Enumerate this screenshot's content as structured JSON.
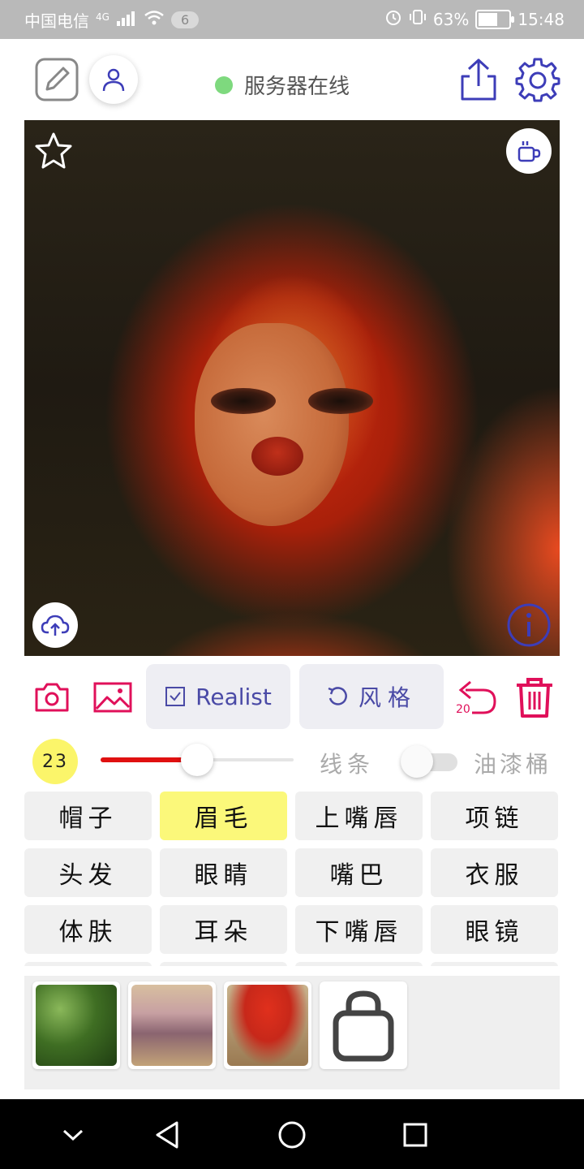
{
  "status_bar": {
    "carrier": "中国电信",
    "network": "4G",
    "notification_count": "6",
    "battery": "63%",
    "battery_level": 0.63,
    "time": "15:48"
  },
  "header": {
    "server_status": "服务器在线",
    "server_status_color": "#7ed97e"
  },
  "toolbar": {
    "model_label": "Realist",
    "style_label": "风格",
    "undo_count": "20",
    "accent_color": "#e0105a"
  },
  "brush": {
    "size": "23",
    "slider_fraction": 0.5,
    "line_label": "线条",
    "bucket_label": "油漆桶",
    "bucket_enabled": false
  },
  "labels": [
    {
      "text": "帽子",
      "selected": false
    },
    {
      "text": "眉毛",
      "selected": true
    },
    {
      "text": "上嘴唇",
      "selected": false
    },
    {
      "text": "项链",
      "selected": false
    },
    {
      "text": "头发",
      "selected": false
    },
    {
      "text": "眼睛",
      "selected": false
    },
    {
      "text": "嘴巴",
      "selected": false
    },
    {
      "text": "衣服",
      "selected": false
    },
    {
      "text": "体肤",
      "selected": false
    },
    {
      "text": "耳朵",
      "selected": false
    },
    {
      "text": "下嘴唇",
      "selected": false
    },
    {
      "text": "眼镜",
      "selected": false
    },
    {
      "text": "",
      "selected": false
    },
    {
      "text": "",
      "selected": false
    },
    {
      "text": "",
      "selected": false
    },
    {
      "text": "",
      "selected": false
    }
  ],
  "style_thumbnails": [
    {
      "name": "green-texture"
    },
    {
      "name": "pink-flower-texture"
    },
    {
      "name": "red-tree-painting"
    }
  ]
}
